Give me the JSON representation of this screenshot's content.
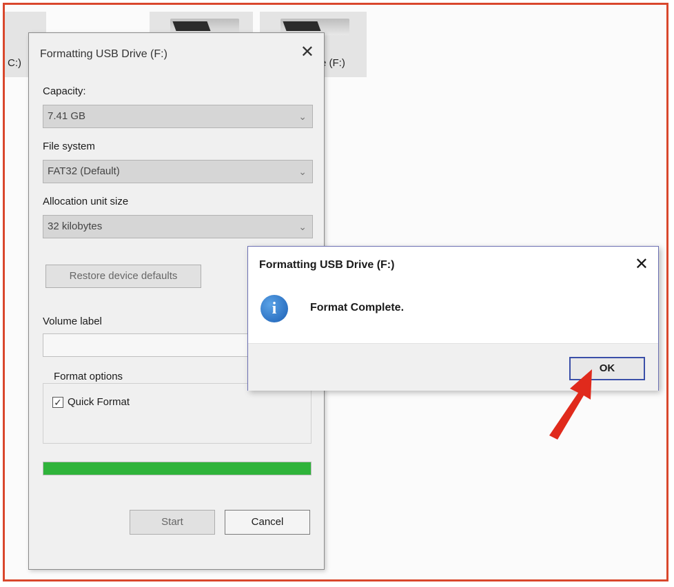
{
  "explorer": {
    "drive_c_label": "C:)",
    "drive_f_label": "e (F:)"
  },
  "format_dialog": {
    "title": "Formatting USB Drive (F:)",
    "close_glyph": "✕",
    "capacity_label": "Capacity:",
    "capacity_value": "7.41 GB",
    "file_system_label": "File system",
    "file_system_value": "FAT32 (Default)",
    "allocation_label": "Allocation unit size",
    "allocation_value": "32 kilobytes",
    "restore_button": "Restore device defaults",
    "volume_label": "Volume label",
    "volume_value": "",
    "format_options_title": "Format options",
    "quick_format_label": "Quick Format",
    "quick_format_checked": true,
    "progress_percent": 100,
    "start_button": "Start",
    "cancel_button": "Cancel",
    "progress_color": "#2fb33a"
  },
  "message_box": {
    "title": "Formatting USB Drive (F:)",
    "close_glyph": "✕",
    "icon": "info-icon",
    "text": "Format Complete.",
    "ok_button": "OK"
  },
  "annotation": {
    "arrow_color": "#e02a1c"
  }
}
